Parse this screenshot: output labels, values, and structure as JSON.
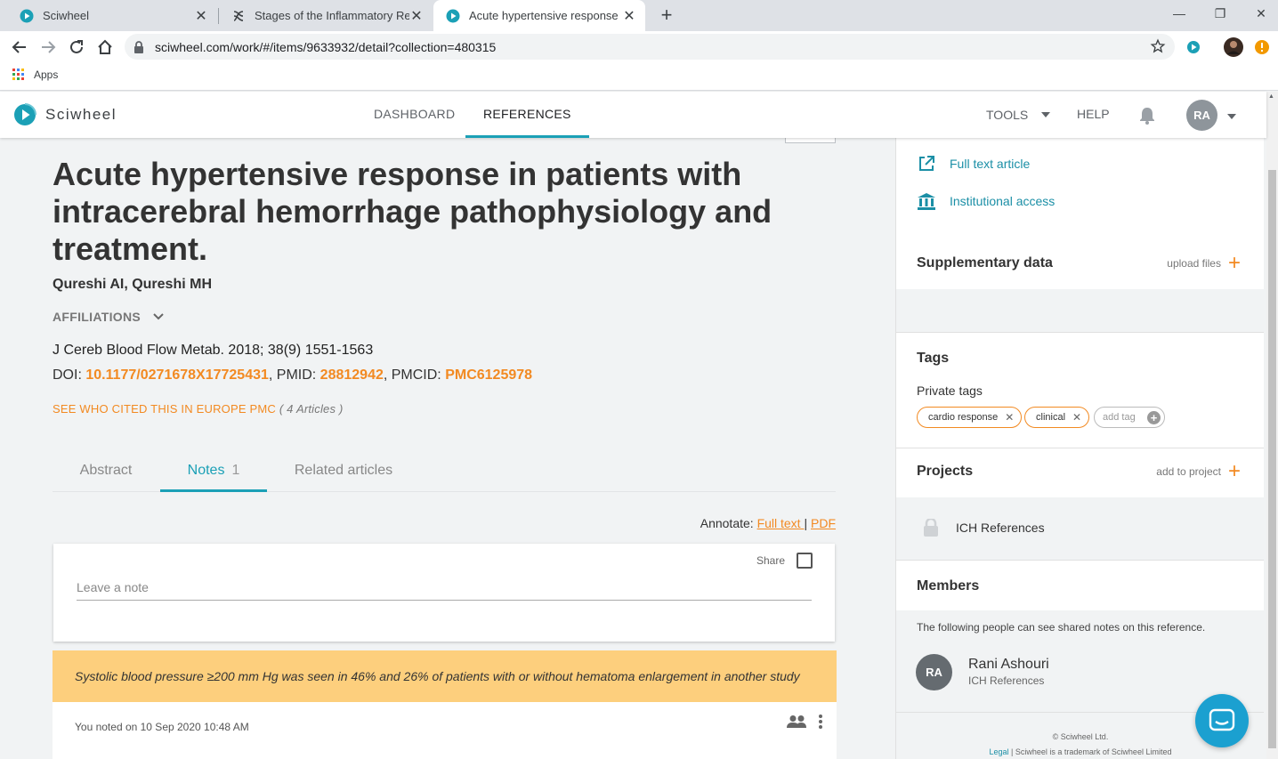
{
  "browser": {
    "tabs": [
      {
        "title": "Sciwheel",
        "active": false
      },
      {
        "title": "Stages of the Inflammatory Resp",
        "active": false
      },
      {
        "title": "Acute hypertensive response in p",
        "active": true
      }
    ],
    "url": "sciwheel.com/work/#/items/9633932/detail?collection=480315",
    "bookmarks_apps": "Apps"
  },
  "header": {
    "brand": "Sciwheel",
    "nav": [
      {
        "label": "DASHBOARD",
        "active": false
      },
      {
        "label": "REFERENCES",
        "active": true
      }
    ],
    "tools": "TOOLS",
    "help": "HELP",
    "user_initials": "RA"
  },
  "article": {
    "title": "Acute hypertensive response in patients with intracerebral hemorrhage pathophysiology and treatment.",
    "authors": "Qureshi AI, Qureshi MH",
    "affiliations_label": "AFFILIATIONS",
    "journal": "J Cereb Blood Flow Metab. 2018; 38(9) 1551-1563",
    "doi_label": "DOI: ",
    "doi": "10.1177/0271678X17725431",
    "pmid_label": ", PMID: ",
    "pmid": "28812942",
    "pmcid_label": ", PMCID: ",
    "pmcid": "PMC6125978",
    "cited_label": "SEE WHO CITED THIS IN EUROPE PMC",
    "cited_count": "( 4 Articles )"
  },
  "content_tabs": {
    "abstract": "Abstract",
    "notes": "Notes",
    "notes_count": "1",
    "related": "Related articles"
  },
  "annotate": {
    "label": "Annotate: ",
    "full_text": "Full text ",
    "separator": " | ",
    "pdf": "PDF"
  },
  "note_editor": {
    "share_label": "Share",
    "placeholder": "Leave a note"
  },
  "note": {
    "highlight": "Systolic blood pressure ≥200 mm Hg was seen in 46% and 26% of patients with or without hematoma enlargement in another study",
    "meta": "You noted on 10 Sep 2020 10:48 AM"
  },
  "sidebar": {
    "full_text_article": "Full text article",
    "institutional_access": "Institutional access",
    "supplementary_title": "Supplementary data",
    "upload_files": "upload files",
    "tags_title": "Tags",
    "private_tags_label": "Private tags",
    "tags": [
      "cardio response",
      "clinical"
    ],
    "add_tag": "add tag",
    "projects_title": "Projects",
    "add_to_project": "add to project",
    "project_name": "ICH References",
    "members_title": "Members",
    "members_note": "The following people can see shared notes on this reference.",
    "member": {
      "initials": "RA",
      "name": "Rani Ashouri",
      "project": "ICH References"
    },
    "copyright": "© Sciwheel Ltd.",
    "legal": "Legal",
    "trademark": " | Sciwheel is a trademark of Sciwheel Limited"
  },
  "colors": {
    "accent_teal": "#1ba0b6",
    "accent_orange": "#f28a22",
    "highlight_yellow": "#fdcf7d"
  }
}
